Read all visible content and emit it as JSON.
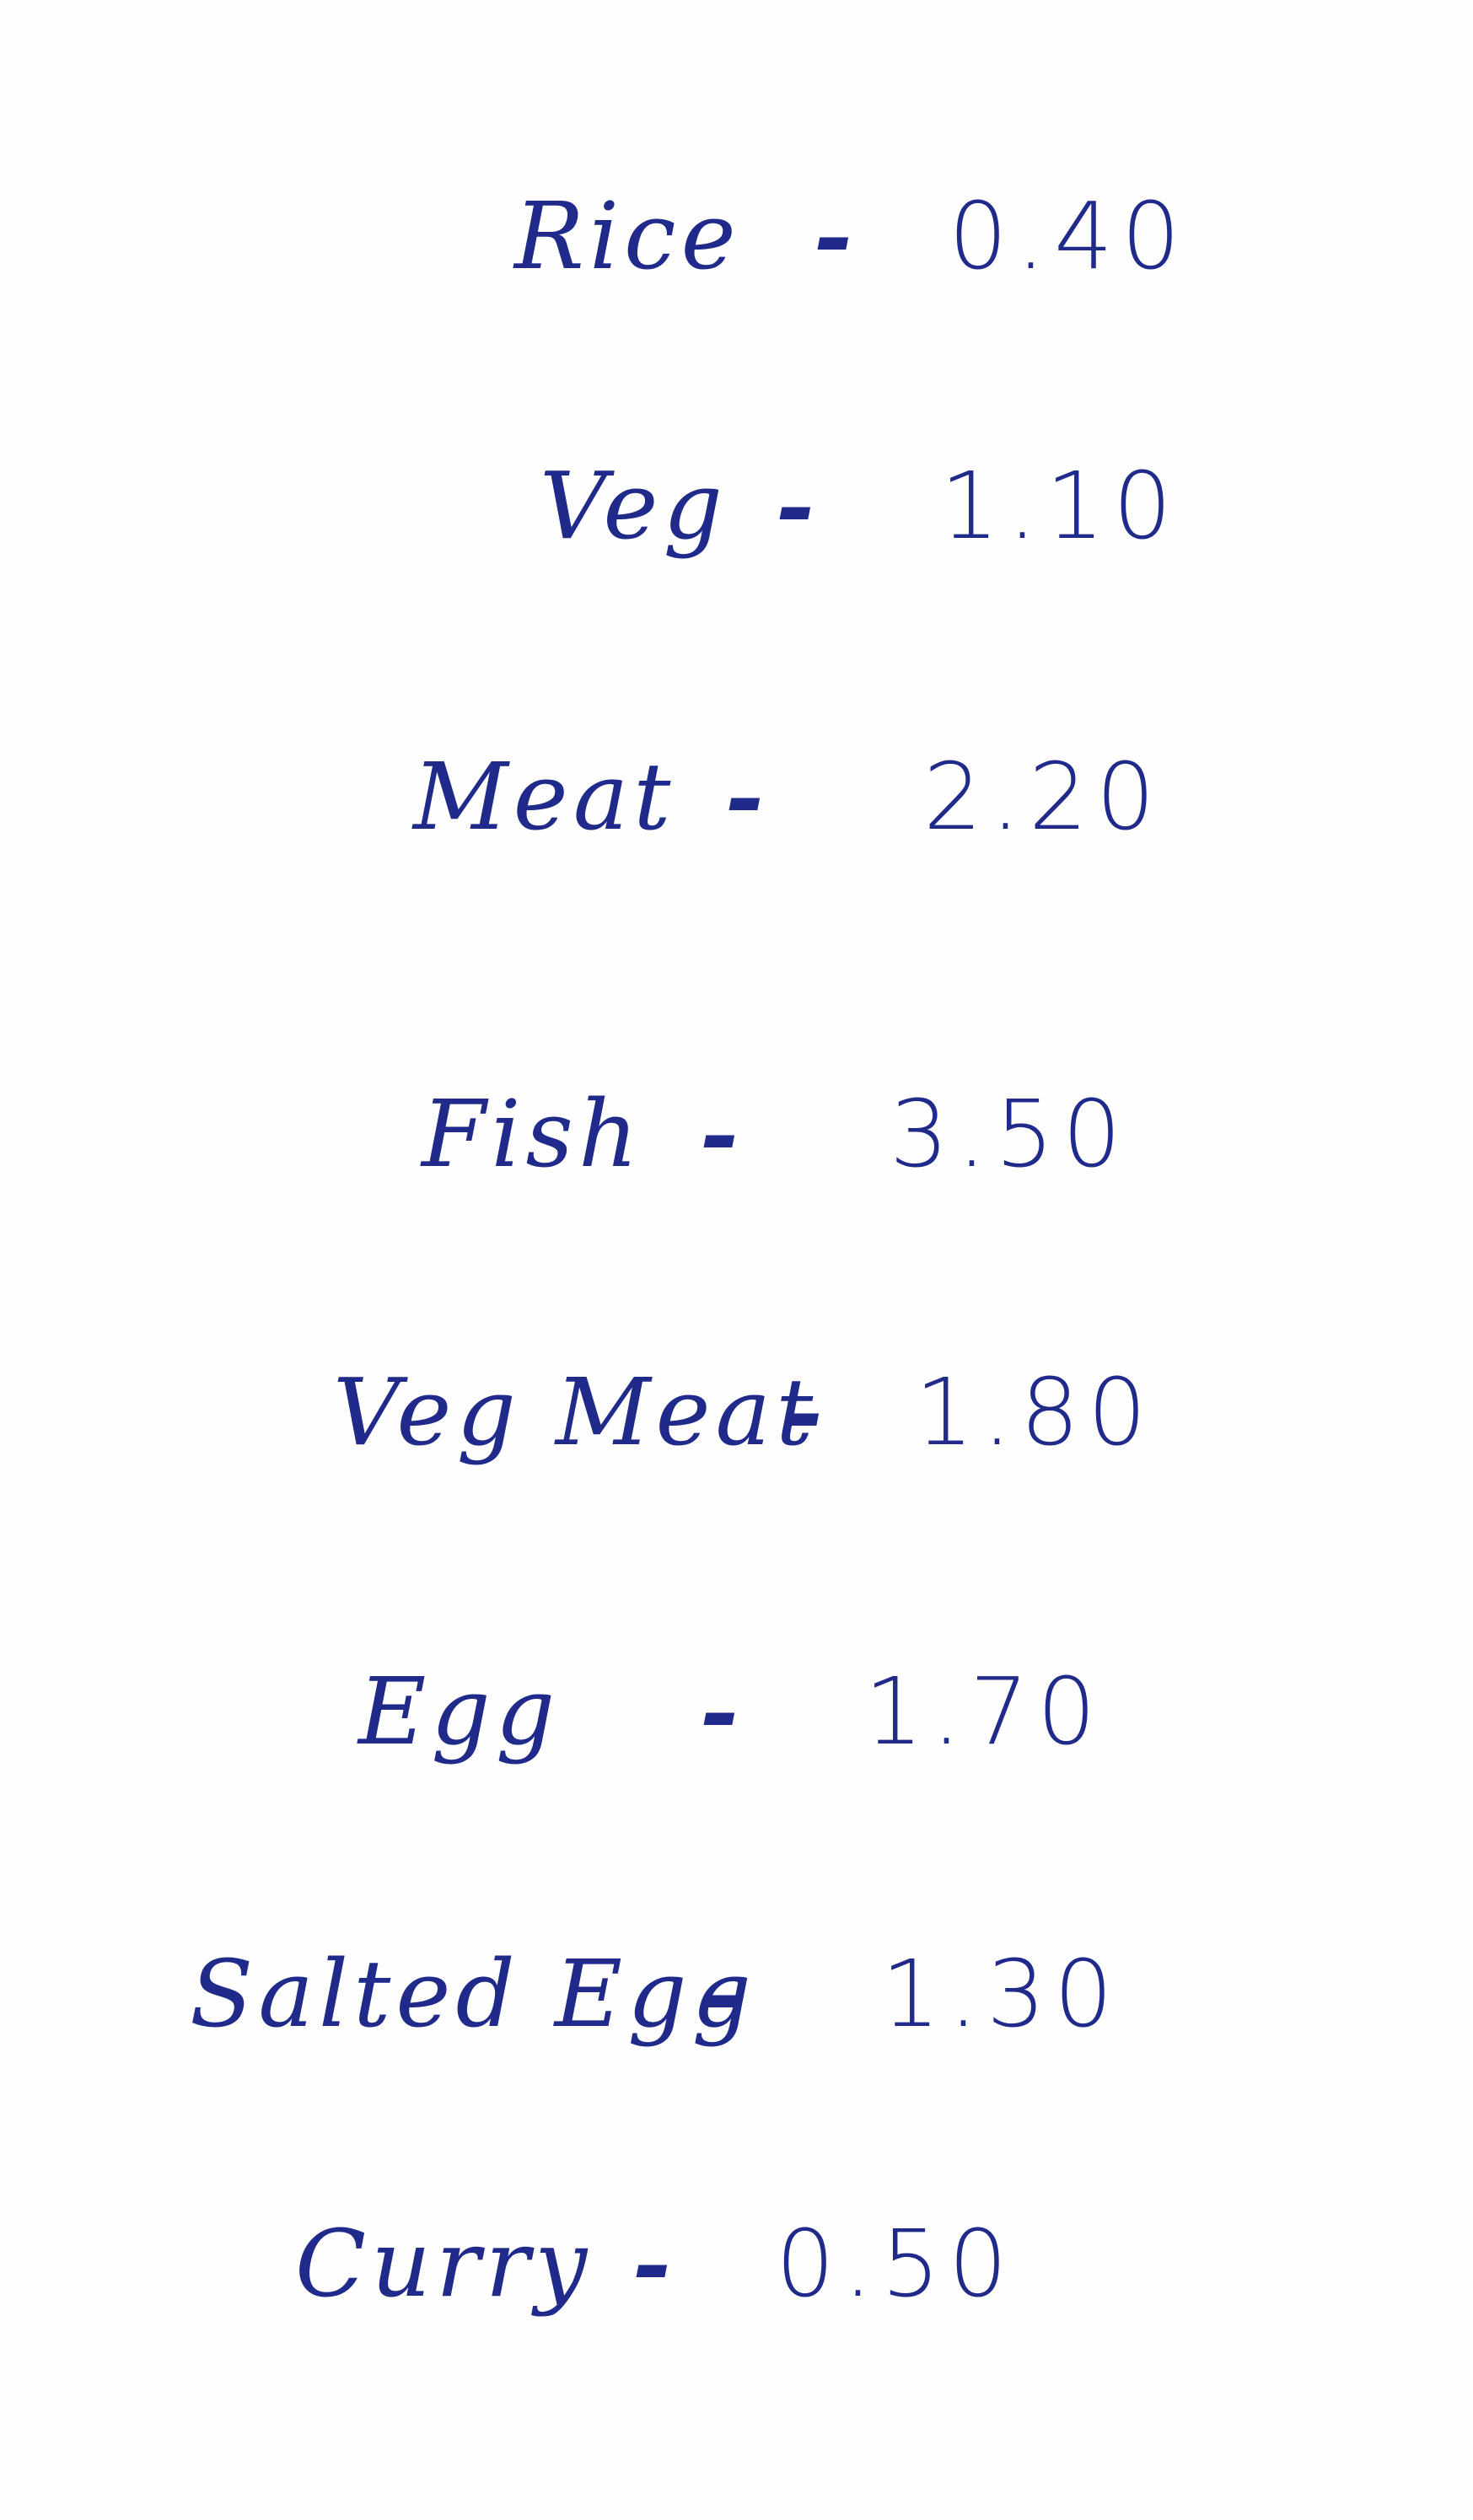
{
  "list": {
    "items": [
      {
        "name": "Rice",
        "dash": "-",
        "price": "0.40"
      },
      {
        "name": "Veg",
        "dash": "-",
        "price": "1.10"
      },
      {
        "name": "Meat",
        "dash": "-",
        "price": "2.20"
      },
      {
        "name": "Fish",
        "dash": "-",
        "price": "3.50"
      },
      {
        "name": "Veg Meat",
        "dash": "-",
        "price": "1.80"
      },
      {
        "name": "Egg",
        "dash": "-",
        "price": "1.70"
      },
      {
        "name": "Salted Egg",
        "dash": "-",
        "price": "1.30"
      },
      {
        "name": "Curry",
        "dash": "-",
        "price": "0.50"
      }
    ]
  },
  "colors": {
    "ink": "#1f2a8a",
    "paper": "#fefefe"
  }
}
